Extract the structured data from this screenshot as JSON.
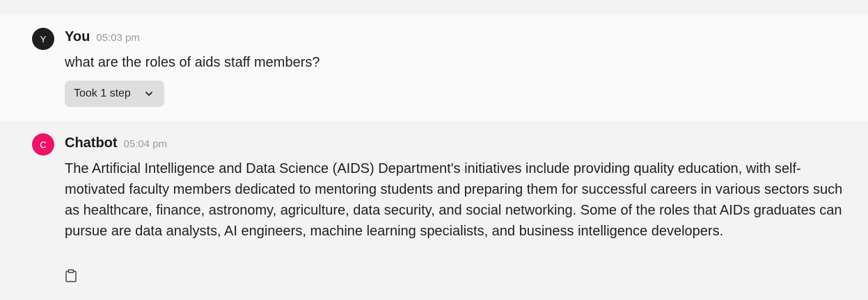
{
  "messages": {
    "user": {
      "avatar_letter": "Y",
      "author": "You",
      "time": "05:03 pm",
      "text": "what are the roles of aids staff members?",
      "steps_label": "Took 1 step"
    },
    "bot": {
      "avatar_letter": "C",
      "author": "Chatbot",
      "time": "05:04 pm",
      "text": "The Artificial Intelligence and Data Science (AIDS) Department's initiatives include providing quality education, with self-motivated faculty members dedicated to mentoring students and preparing them for successful careers in various sectors such as healthcare, finance, astronomy, agriculture, data security, and social networking. Some of the roles that AIDs graduates can pursue are data analysts, AI engineers, machine learning specialists, and business intelligence developers."
    }
  },
  "colors": {
    "user_avatar": "#1e1e1e",
    "bot_avatar": "#ee1367",
    "steps_button_bg": "#dedede"
  },
  "icons": {
    "steps_toggle": "chevron-down-icon",
    "copy": "clipboard-icon"
  }
}
